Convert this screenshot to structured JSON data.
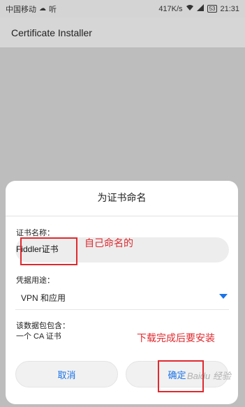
{
  "status_bar": {
    "carrier": "中国移动",
    "carrier_suffix": "听",
    "speed": "417K/s",
    "battery": "53",
    "time": "21:31",
    "icons": [
      "wechat-bubble-icon",
      "wifi-icon",
      "signal-icon",
      "battery-icon"
    ]
  },
  "app_bar": {
    "title": "Certificate Installer"
  },
  "dialog": {
    "title": "为证书命名",
    "name_label": "证书名称：",
    "name_value": "Fiddler证书",
    "usage_label": "凭据用途：",
    "usage_value": "VPN 和应用",
    "package_label": "该数据包包含：",
    "package_value": "一个 CA 证书",
    "cancel_label": "取消",
    "ok_label": "确定"
  },
  "annotations": {
    "self_named": "自己命名的",
    "install_after": "下载完成后要安装"
  },
  "watermark": "Baidu 经验",
  "colors": {
    "accent": "#1a73e8",
    "annotation_red": "#e0292e"
  }
}
